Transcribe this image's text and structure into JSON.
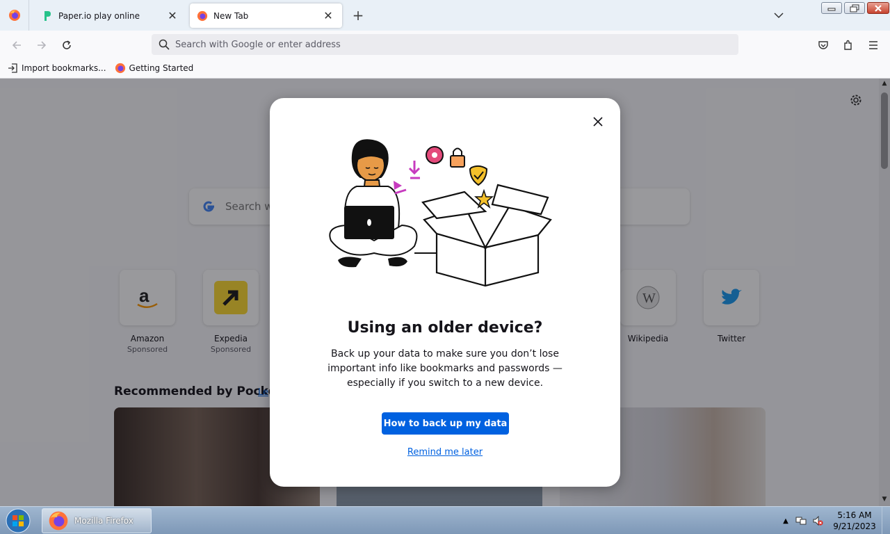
{
  "browser": {
    "tabs": [
      {
        "title": "Paper.io play online",
        "favicon": "paperio-icon"
      },
      {
        "title": "New Tab",
        "favicon": "firefox-icon"
      }
    ],
    "address_placeholder": "Search with Google or enter address",
    "bookmarks": [
      {
        "label": "Import bookmarks...",
        "icon": "import-icon"
      },
      {
        "label": "Getting Started",
        "icon": "firefox-icon"
      }
    ]
  },
  "newtab": {
    "search_placeholder": "Search w",
    "shortcuts": [
      {
        "name": "Amazon",
        "sponsored": "Sponsored"
      },
      {
        "name": "Expedia",
        "sponsored": "Sponsored"
      },
      {
        "name": "Wikipedia"
      },
      {
        "name": "Twitter"
      }
    ],
    "pocket_heading": "Recommended by Pocket",
    "pocket_link": "Le"
  },
  "modal": {
    "title": "Using an older device?",
    "body": "Back up your data to make sure you don’t lose important info like bookmarks and passwords — especially if you switch to a new device.",
    "primary_button": "How to back up my data",
    "secondary_link": "Remind me later"
  },
  "taskbar": {
    "app_label": "Mozilla Firefox",
    "time": "5:16 AM",
    "date": "9/21/2023"
  },
  "colors": {
    "accent": "#0061e0",
    "tab_strip": "#e9f0f7",
    "toolbar": "#f9f9fb"
  }
}
